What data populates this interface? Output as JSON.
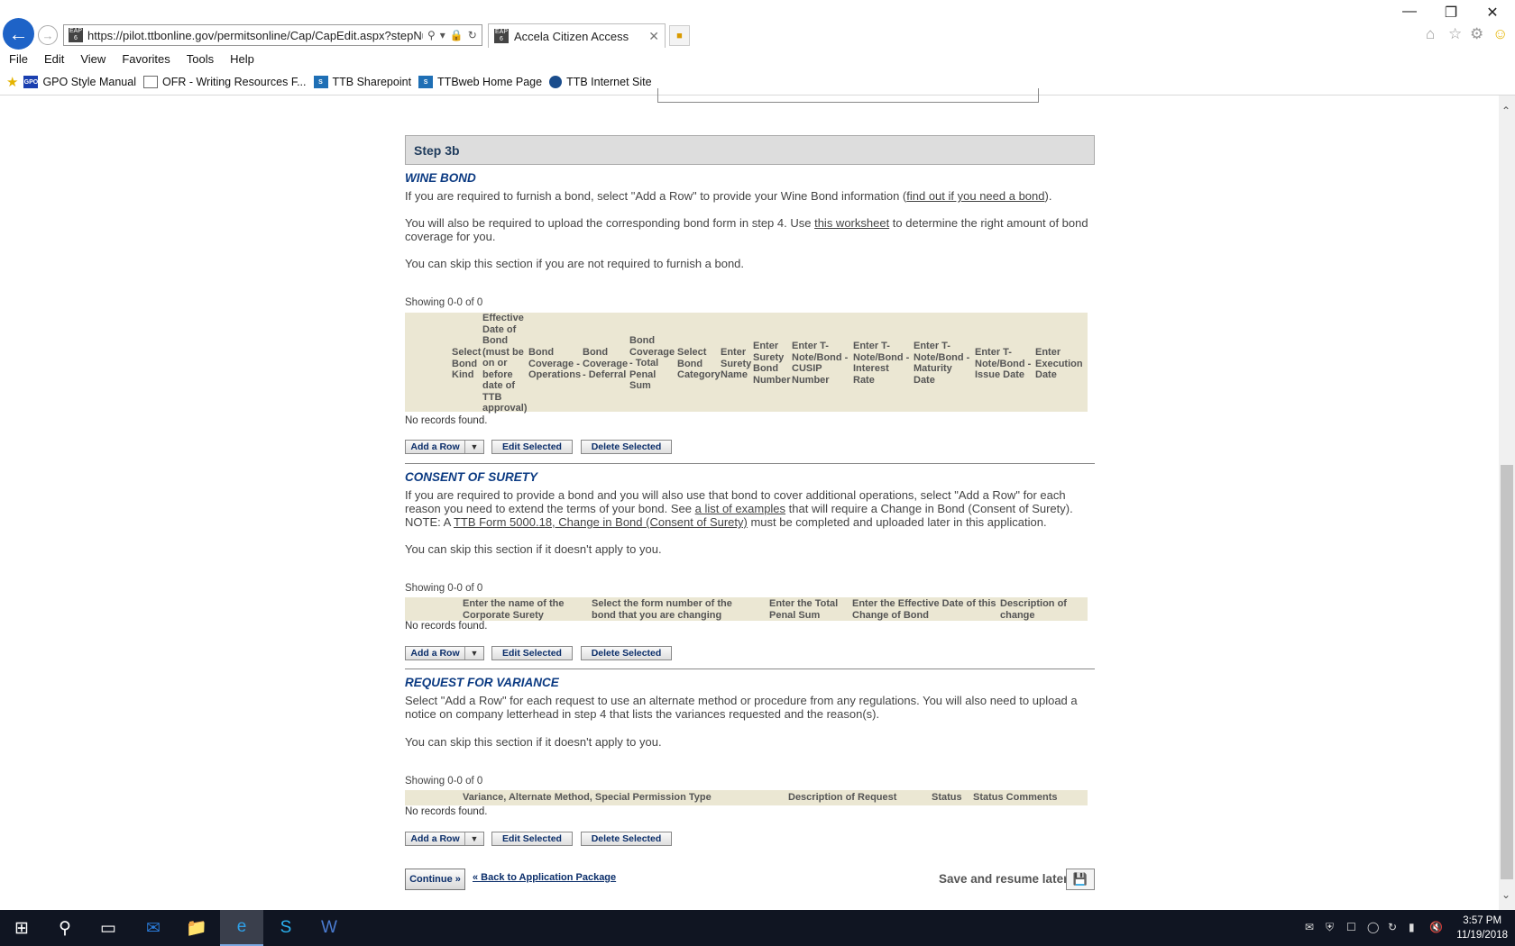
{
  "browser": {
    "url": "https://pilot.ttbonline.gov/permitsonline/Cap/CapEdit.aspx?stepNuml",
    "tab_title": "Accela Citizen Access",
    "favicon_text": "EAP 6",
    "menu": [
      "File",
      "Edit",
      "View",
      "Favorites",
      "Tools",
      "Help"
    ],
    "favorites": [
      {
        "label": "GPO Style Manual",
        "icon": "gpo-icon",
        "icon_text": "GPO",
        "color": "#1a3fb0"
      },
      {
        "label": "OFR - Writing Resources F...",
        "icon": "ofr-page-icon",
        "icon_text": "",
        "color": "#6a6a6a"
      },
      {
        "label": "TTB Sharepoint",
        "icon": "sharepoint-icon",
        "icon_text": "S",
        "color": "#1f6fb5"
      },
      {
        "label": "TTBweb Home Page",
        "icon": "sharepoint-icon",
        "icon_text": "S",
        "color": "#1f6fb5"
      },
      {
        "label": "TTB Internet Site",
        "icon": "ttb-seal-icon",
        "icon_text": "",
        "color": "#1a4d8c"
      }
    ]
  },
  "step": {
    "title": "Step 3b"
  },
  "wine_bond": {
    "title": "WINE BOND",
    "para1_a": "If you are required to furnish a bond, select \"Add a Row\" to provide your Wine Bond information (",
    "para1_link": "find out if you need a bond",
    "para1_b": ").",
    "para2_a": "You will also be required to upload the corresponding bond form in step 4. Use ",
    "para2_link": "this worksheet",
    "para2_b": " to determine the right amount of bond coverage for you.",
    "para3": "You can skip this section if you are not required to furnish a bond.",
    "showing": "Showing 0-0 of 0",
    "columns": [
      "Select Bond Kind",
      "Effective Date of Bond (must be on or before date of TTB approval)",
      "Bond Coverage - Operations",
      "Bond Coverage - Deferral",
      "Bond Coverage - Total Penal Sum",
      "Select Bond Category",
      "Enter Surety Name",
      "Enter Surety Bond Number",
      "Enter T-Note/Bond - CUSIP Number",
      "Enter T-Note/Bond - Interest Rate",
      "Enter T-Note/Bond - Maturity Date",
      "Enter T-Note/Bond - Issue Date",
      "Enter Execution Date"
    ],
    "no_records": "No records found.",
    "add_row": "Add a Row",
    "edit": "Edit Selected",
    "delete": "Delete Selected"
  },
  "consent": {
    "title": "CONSENT OF SURETY",
    "para1_a": "If you are required to provide a bond and you will also use that bond to cover additional operations, select \"Add a Row\" for each reason you need to extend the terms of your bond. See ",
    "para1_link": "a list of examples",
    "para1_b": " that will require a Change in Bond (Consent of Surety). NOTE: A ",
    "para1_link2": "TTB Form 5000.18, Change in Bond (Consent of Surety)",
    "para1_c": " must be completed and uploaded later in this application.",
    "para2": "You can skip this section if it doesn't apply to you.",
    "showing": "Showing 0-0 of 0",
    "columns": [
      "Enter the name of the Corporate Surety",
      "Select the form number of the bond that you are changing",
      "Enter the Total Penal Sum",
      "Enter the Effective Date of this Change of Bond",
      "Description of change"
    ],
    "no_records": "No records found.",
    "add_row": "Add a Row",
    "edit": "Edit Selected",
    "delete": "Delete Selected"
  },
  "variance": {
    "title": "REQUEST FOR VARIANCE",
    "para1": "Select \"Add a Row\" for each request to use an alternate method or procedure from any regulations. You will also need to upload a notice on company letterhead in step 4 that lists the variances requested and the reason(s).",
    "para2": "You can skip this section if it doesn't apply to you.",
    "showing": "Showing 0-0 of 0",
    "columns": [
      "Variance, Alternate Method, Special Permission Type",
      "Description of Request",
      "Status",
      "Status Comments"
    ],
    "no_records": "No records found.",
    "add_row": "Add a Row",
    "edit": "Edit Selected",
    "delete": "Delete Selected"
  },
  "footer": {
    "continue": "Continue »",
    "back_link": "« Back to Application Package",
    "save_label": "Save and resume later:"
  },
  "taskbar": {
    "time": "3:57 PM",
    "date": "11/19/2018"
  }
}
